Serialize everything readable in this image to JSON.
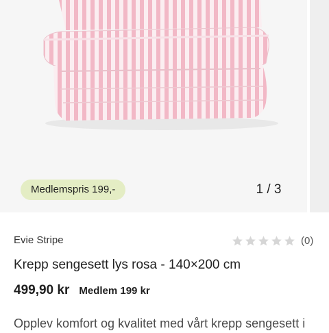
{
  "gallery": {
    "member_badge": "Medlemspris 199,-",
    "counter": "1 / 3",
    "image_alt": "Krepp sengesett lys rosa"
  },
  "product": {
    "brand": "Evie Stripe",
    "rating": {
      "stars": 0,
      "max": 5,
      "count_label": "(0)"
    },
    "title": "Krepp sengesett lys rosa - 140×200 cm",
    "price": "499,90 kr",
    "member_price": "Medlem 199 kr",
    "description": "Opplev komfort og kvalitet med vårt krepp sengesett i"
  },
  "colors": {
    "badge_bg": "#e4edc4",
    "stripe_pink": "#f2b8c6",
    "star_empty": "#d6d6d6"
  }
}
